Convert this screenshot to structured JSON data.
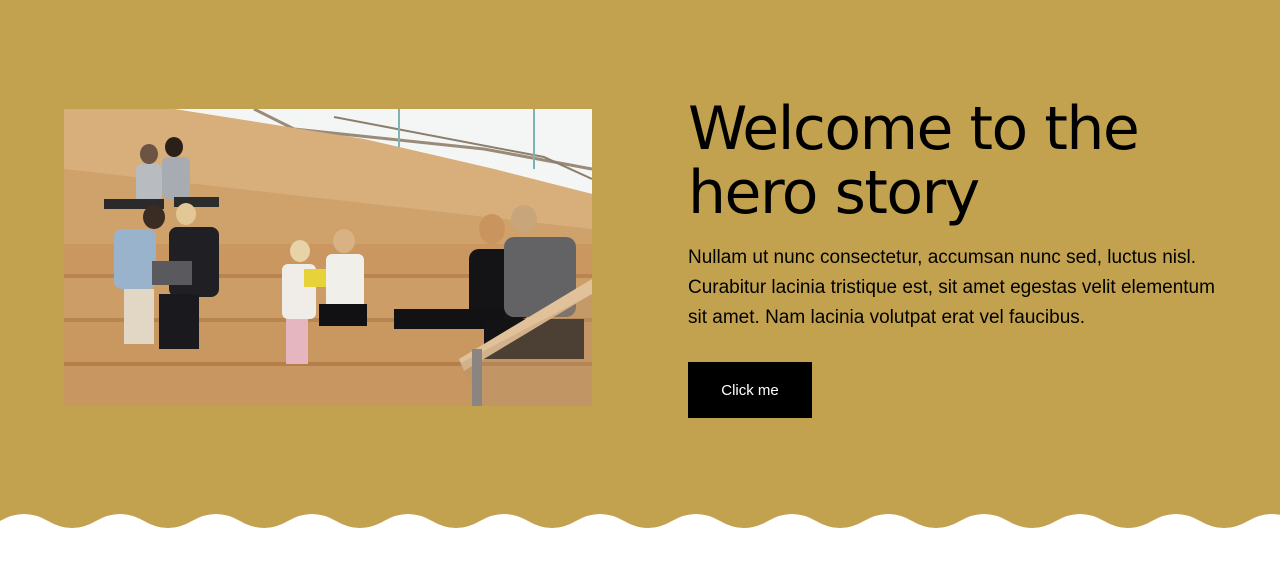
{
  "hero": {
    "title": "Welcome to the hero story",
    "body": "Nullam ut nunc consectetur, accumsan nunc sed, luctus nisl. Curabitur lacinia tristique est, sit amet egestas velit elementum sit amet. Nam lacinia volutpat erat vel faucibus.",
    "button_label": "Click me",
    "image_icon": "photo-people-on-wooden-steps"
  },
  "colors": {
    "background": "#c2a24f",
    "button": "#000000",
    "button_text": "#ffffff",
    "page_bottom": "#ffffff"
  }
}
